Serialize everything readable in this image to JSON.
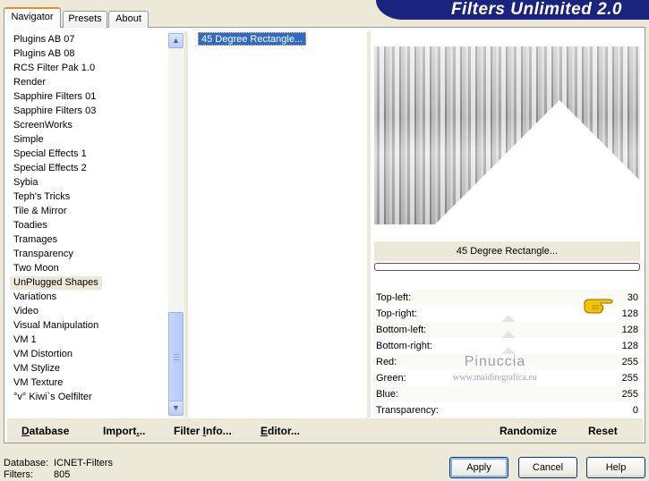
{
  "app": {
    "title": "Filters Unlimited 2.0"
  },
  "tabs": [
    {
      "label": "Navigator",
      "active": true
    },
    {
      "label": "Presets",
      "active": false
    },
    {
      "label": "About",
      "active": false
    }
  ],
  "categories": {
    "selected_index": 17,
    "items": [
      "Plugins AB 07",
      "Plugins AB 08",
      "RCS Filter Pak 1.0",
      "Render",
      "Sapphire Filters 01",
      "Sapphire Filters 03",
      "ScreenWorks",
      "Simple",
      "Special Effects 1",
      "Special Effects 2",
      "Sybia",
      "Teph's Tricks",
      "Tile & Mirror",
      "Toadies",
      "Tramages",
      "Transparency",
      "Two Moon",
      "UnPlugged Shapes",
      "Variations",
      "Video",
      "Visual Manipulation",
      "VM 1",
      "VM Distortion",
      "VM Stylize",
      "VM Texture",
      "°v° Kiwi`s Oelfilter"
    ]
  },
  "scrollbar": {
    "up_icon": "chevron-up-icon",
    "down_icon": "chevron-down-icon"
  },
  "filters": {
    "items": [
      "45 Degree Rectangle..."
    ],
    "selected_index": 0
  },
  "preview": {
    "filter_name": "45 Degree Rectangle..."
  },
  "params": [
    {
      "label": "Top-left:",
      "value": "30"
    },
    {
      "label": "Top-right:",
      "value": "128"
    },
    {
      "label": "Bottom-left:",
      "value": "128"
    },
    {
      "label": "Bottom-right:",
      "value": "128"
    },
    {
      "label": "Red:",
      "value": "255"
    },
    {
      "label": "Green:",
      "value": "255"
    },
    {
      "label": "Blue:",
      "value": "255"
    },
    {
      "label": "Transparency:",
      "value": "0"
    }
  ],
  "watermark": {
    "name": "Pinuccia",
    "url": "www.maidiregrafica.eu"
  },
  "toolbar": {
    "database": {
      "u": "D",
      "rest": "atabase"
    },
    "import": {
      "pre": "Import",
      "u": ".",
      "post": ".."
    },
    "filter_info": {
      "pre": "Filter ",
      "u": "I",
      "post": "nfo..."
    },
    "editor": {
      "pre": "",
      "u": "E",
      "post": "ditor..."
    },
    "randomize": "Randomize",
    "reset": "Reset"
  },
  "status": {
    "database_label": "Database:",
    "database_value": "ICNET-Filters",
    "filters_label": "Filters:",
    "filters_value": "805"
  },
  "buttons": {
    "apply": "Apply",
    "cancel": "Cancel",
    "help": "Help"
  }
}
